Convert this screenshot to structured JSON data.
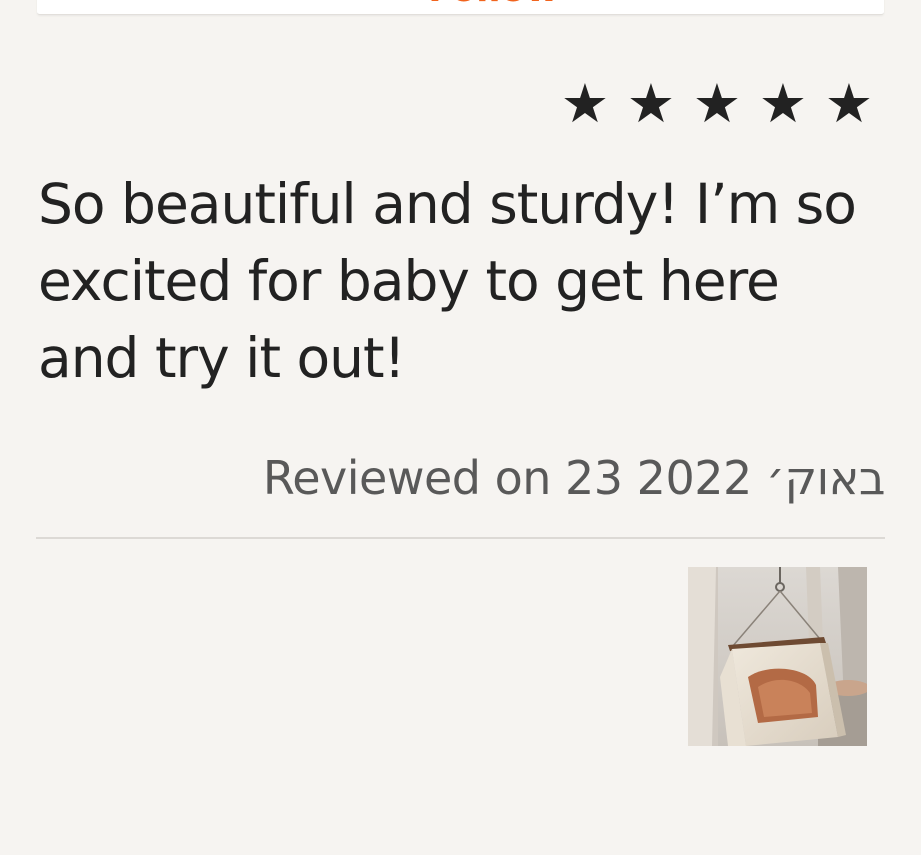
{
  "follow": {
    "label": "Follow",
    "icon": "follow-icon",
    "color": "#f1641e"
  },
  "review": {
    "rating": 5,
    "rating_max": 5,
    "star_icon": "star-icon",
    "text": "So beautiful and sturdy! I’m so excited for baby to get here and try it out!",
    "date": "Reviewed on 23 באוק׳ 2022",
    "photo_icon": "review-photo-thumbnail"
  }
}
